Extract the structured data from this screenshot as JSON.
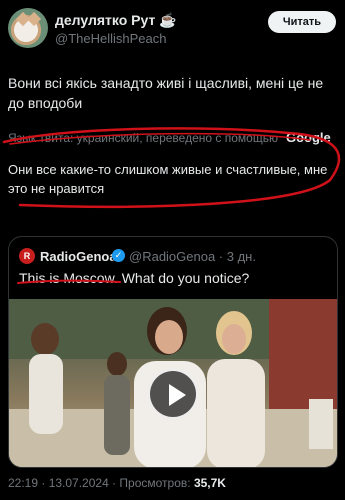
{
  "author": {
    "display_name": "делулятко Рут ☕",
    "handle": "@TheHellishPeach",
    "follow_label": "Читать"
  },
  "tweet": {
    "text": "Вони всі якісь занадто живі і щасливі, мені це не до вподоби",
    "translation_label": "Язык твита: украинский, переведено с помощью",
    "translation_provider": "Google",
    "translation_text": "Они все какие-то слишком живые и счастливые, мне это не нравится"
  },
  "quoted": {
    "avatar_letter": "R",
    "name": "RadioGenoa",
    "verified_icon": "verified-badge-icon",
    "handle": "@RadioGenoa · 3 дн.",
    "text": "This is Moscow. What do you notice?",
    "media_icon": "play-icon"
  },
  "meta": {
    "timestamp": "22:19 · 13.07.2024 · Просмотров:",
    "views": "35,7K"
  },
  "colors": {
    "background": "#000000",
    "accent": "#1d9bf0",
    "annotation_red": "#d0111a"
  }
}
